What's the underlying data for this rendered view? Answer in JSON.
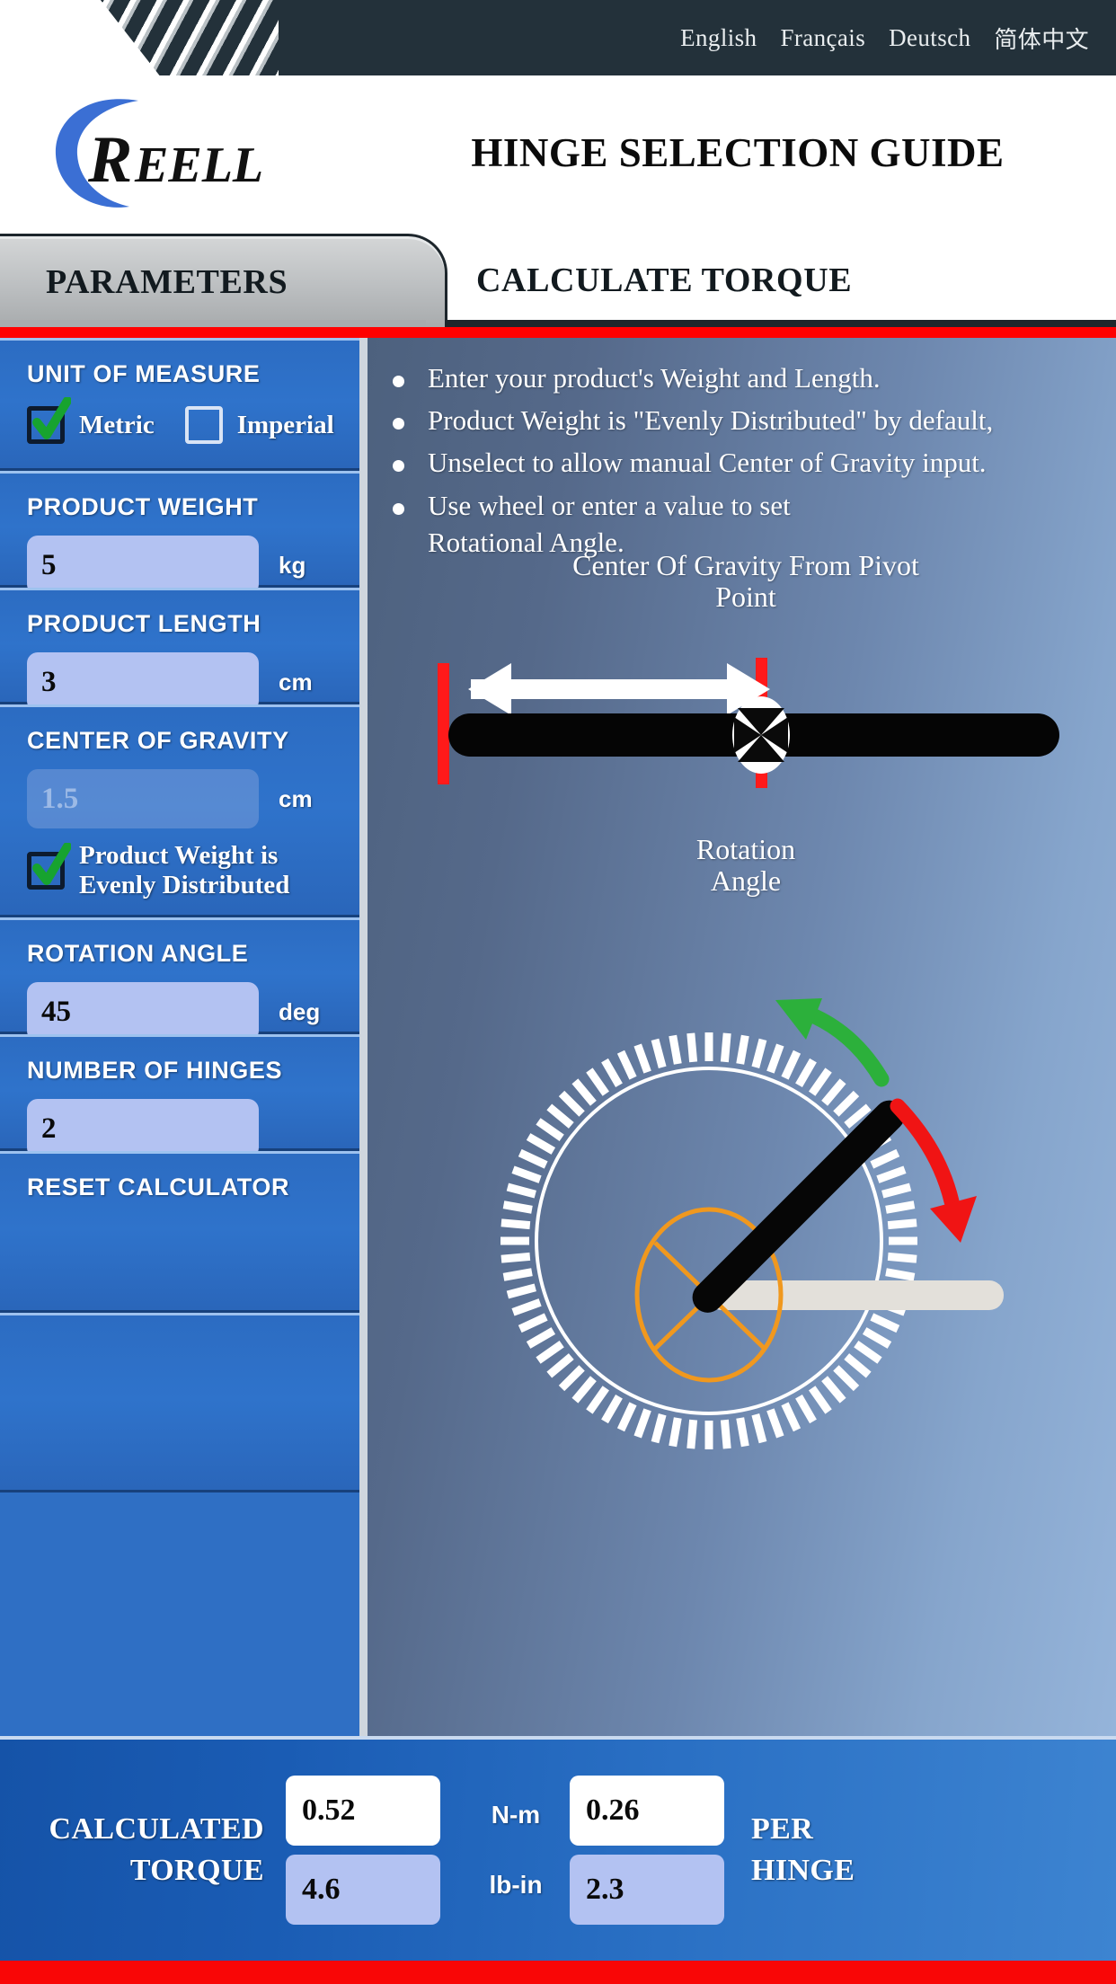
{
  "topbar": {
    "languages": [
      {
        "label": "English",
        "code": "en"
      },
      {
        "label": "Français",
        "code": "fr"
      },
      {
        "label": "Deutsch",
        "code": "de"
      },
      {
        "label": "简体中文",
        "code": "zh"
      }
    ]
  },
  "brand": {
    "logo_text": "REELL",
    "app_title": "HINGE SELECTION GUIDE"
  },
  "tabs": [
    {
      "label": "PARAMETERS",
      "active": true
    },
    {
      "label": "CALCULATE TORQUE",
      "active": false
    }
  ],
  "colors": {
    "accent_red": "#ff0000",
    "topbar_dark": "#23313a",
    "panel_blue": "#2f73cb",
    "input_blue": "#b3c2f2",
    "check_green": "#17a32f",
    "brand_blue": "#3b6fd4"
  },
  "sidebar": {
    "unit_of_measure": {
      "label": "UNIT OF MEASURE",
      "options": [
        {
          "label": "Metric",
          "checked": true
        },
        {
          "label": "Imperial",
          "checked": false
        }
      ]
    },
    "product_weight": {
      "label": "PRODUCT WEIGHT",
      "value": "5",
      "unit": "kg",
      "disabled": false
    },
    "product_length": {
      "label": "PRODUCT LENGTH",
      "value": "3",
      "unit": "cm",
      "disabled": false
    },
    "center_of_gravity": {
      "label": "CENTER OF GRAVITY",
      "value": "1.5",
      "unit": "cm",
      "disabled": true,
      "checkbox": {
        "label": "Product Weight is Evenly Distributed",
        "checked": true
      }
    },
    "rotation_angle": {
      "label": "ROTATION ANGLE",
      "value": "45",
      "unit": "deg",
      "disabled": false
    },
    "number_of_hinges": {
      "label": "NUMBER OF HINGES",
      "value": "2",
      "unit": "",
      "disabled": false
    },
    "reset": {
      "label": "RESET CALCULATOR"
    }
  },
  "main": {
    "instructions": [
      "Enter your product's Weight and Length.",
      "Product Weight is \"Evenly Distributed\" by default,",
      "Unselect to allow manual Center of Gravity input.",
      "Use wheel or enter a value to set Rotational Angle."
    ],
    "cog_diagram": {
      "caption_line1": "Center Of Gravity From Pivot",
      "caption_line2": "Point"
    },
    "rotation_diagram": {
      "caption_line1": "Rotation",
      "caption_line2": "Angle",
      "angle_value": 45
    }
  },
  "results": {
    "label_line1": "CALCULATED",
    "label_line2": "TORQUE",
    "total_nm": "0.52",
    "total_lbin": "4.6",
    "per_hinge_nm": "0.26",
    "per_hinge_lbin": "2.3",
    "unit_nm": "N-m",
    "unit_lbin": "lb-in",
    "right_label_line1": "PER",
    "right_label_line2": "HINGE"
  }
}
